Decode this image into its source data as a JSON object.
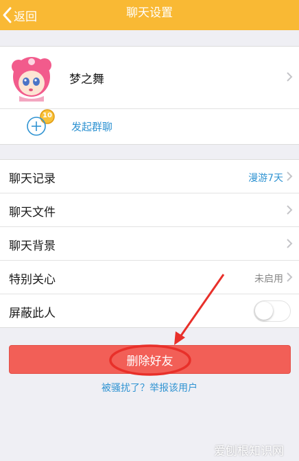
{
  "nav": {
    "back_label": "返回",
    "title": "聊天设置"
  },
  "friend": {
    "name": "梦之舞",
    "badge": "10"
  },
  "actions": {
    "start_group_chat": "发起群聊"
  },
  "settings": {
    "chat_history": {
      "label": "聊天记录",
      "value": "漫游7天"
    },
    "chat_files": {
      "label": "聊天文件"
    },
    "chat_background": {
      "label": "聊天背景"
    },
    "special_care": {
      "label": "特别关心",
      "value": "未启用"
    },
    "block_person": {
      "label": "屏蔽此人",
      "toggle_on": false
    }
  },
  "delete_button": {
    "label": "删除好友"
  },
  "report_link": "被骚扰了？举报该用户",
  "watermark": "爱刨根知识网",
  "colors": {
    "nav": "#f9b934",
    "link": "#2f93d2",
    "danger": "#f25f57",
    "annotation": "#e8302a"
  }
}
